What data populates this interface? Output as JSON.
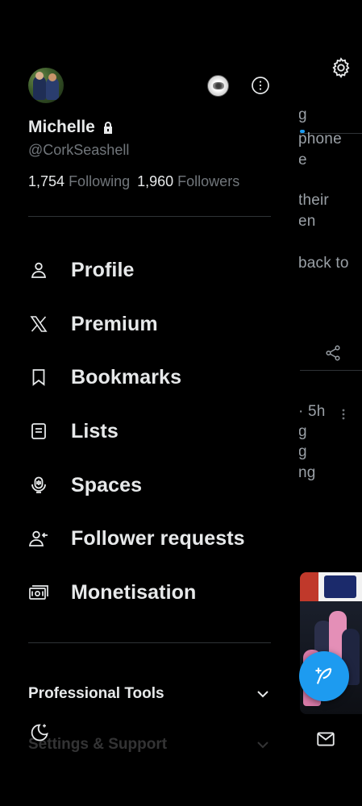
{
  "feed": {
    "snippets": [
      "g",
      "phone",
      "e",
      "their",
      "en",
      "back to",
      "· 5h",
      "g",
      "g",
      "ng"
    ]
  },
  "profile": {
    "display_name": "Michelle",
    "handle": "@CorkSeashell",
    "following_count": "1,754",
    "following_label": "Following",
    "followers_count": "1,960",
    "followers_label": "Followers"
  },
  "menu": {
    "items": [
      {
        "label": "Profile",
        "icon": "person-icon"
      },
      {
        "label": "Premium",
        "icon": "x-logo-icon"
      },
      {
        "label": "Bookmarks",
        "icon": "bookmark-icon"
      },
      {
        "label": "Lists",
        "icon": "list-icon"
      },
      {
        "label": "Spaces",
        "icon": "microphone-icon"
      },
      {
        "label": "Follower requests",
        "icon": "person-add-icon"
      },
      {
        "label": "Monetisation",
        "icon": "money-icon"
      }
    ]
  },
  "sections": {
    "professional_tools": "Professional Tools",
    "settings_support": "Settings & Support"
  },
  "colors": {
    "background": "#000000",
    "text_primary": "#e7e9ea",
    "text_secondary": "#71767b",
    "accent": "#1d9bf0",
    "divider": "#2f3336"
  }
}
